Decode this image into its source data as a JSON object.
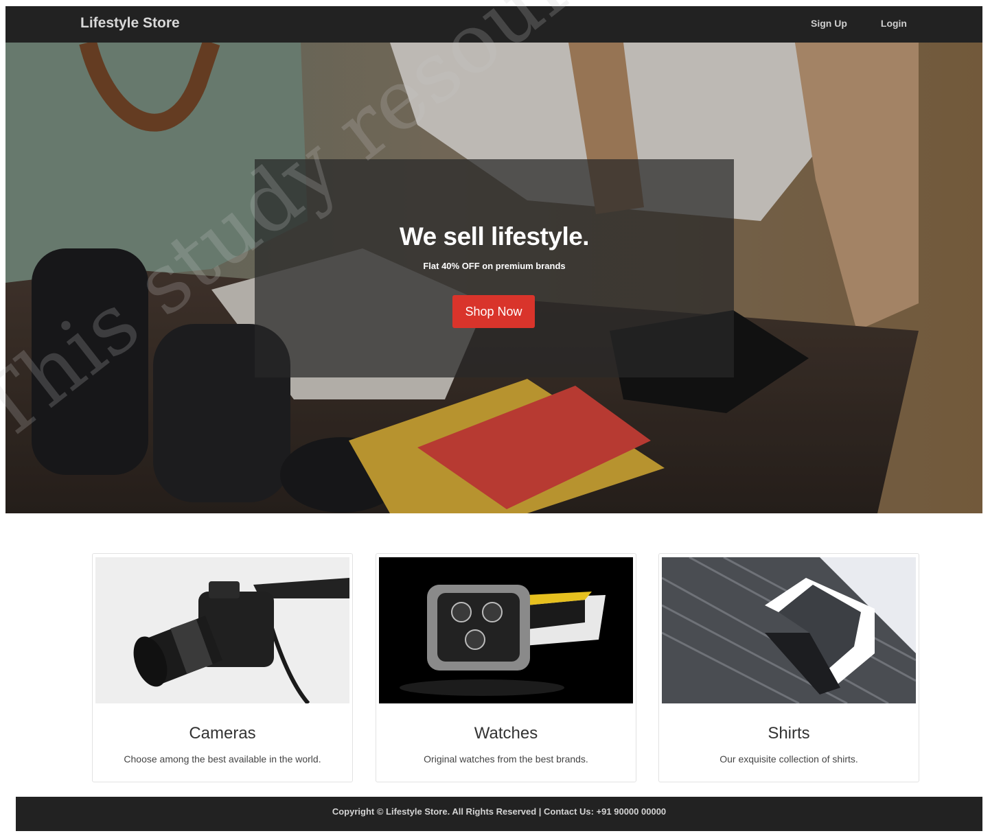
{
  "navbar": {
    "brand": "Lifestyle Store",
    "links": [
      "Sign Up",
      "Login"
    ]
  },
  "hero": {
    "title": "We sell lifestyle.",
    "subtitle": "Flat 40% OFF on premium brands",
    "button": "Shop Now"
  },
  "cards": [
    {
      "title": "Cameras",
      "description": "Choose among the best available in the world."
    },
    {
      "title": "Watches",
      "description": "Original watches from the best brands."
    },
    {
      "title": "Shirts",
      "description": "Our exquisite collection of shirts."
    }
  ],
  "footer": {
    "text": "Copyright © Lifestyle Store. All Rights Reserved | Contact Us: +91 90000 00000"
  },
  "watermark": "This study resource was shared via CourseHero.com",
  "colors": {
    "navbar": "#222222",
    "button": "#d9342b",
    "footer": "#222222"
  }
}
